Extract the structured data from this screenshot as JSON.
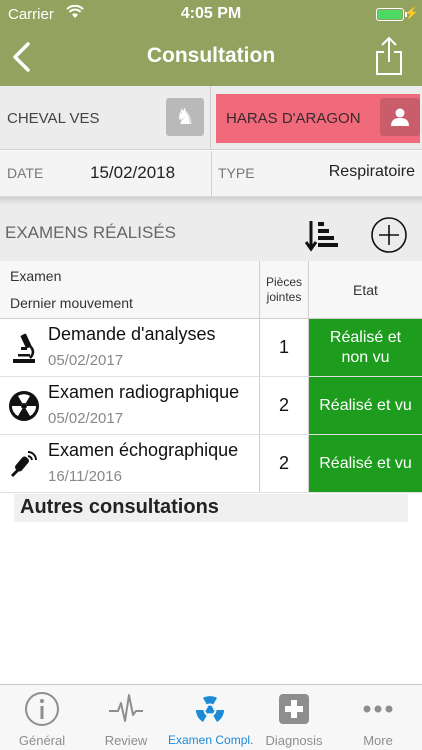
{
  "status_bar": {
    "carrier": "Carrier",
    "time": "4:05 PM"
  },
  "nav": {
    "title": "Consultation"
  },
  "horse": {
    "name": "CHEVAL VES"
  },
  "owner": {
    "name": "HARAS D'ARAGON"
  },
  "details": {
    "date_label": "DATE",
    "date_value": "15/02/2018",
    "type_label": "TYPE",
    "type_value": "Respiratoire"
  },
  "section": {
    "title": "EXAMENS RÉALISÉS"
  },
  "table": {
    "headers": {
      "examen": "Examen",
      "mouvement": "Dernier mouvement",
      "pieces_line1": "Pièces",
      "pieces_line2": "jointes",
      "etat": "Etat"
    },
    "rows": [
      {
        "icon": "microscope-icon",
        "name": "Demande d'analyses",
        "date": "05/02/2017",
        "count": "1",
        "status": "Réalisé et non vu"
      },
      {
        "icon": "radiation-icon",
        "name": "Examen radiographique",
        "date": "05/02/2017",
        "count": "2",
        "status": "Réalisé et vu"
      },
      {
        "icon": "ultrasound-probe-icon",
        "name": "Examen échographique",
        "date": "16/11/2016",
        "count": "2",
        "status": "Réalisé et vu"
      }
    ]
  },
  "autres": {
    "title": "Autres consultations"
  },
  "tabbar": {
    "tabs": [
      {
        "label": "Général",
        "icon": "info-icon"
      },
      {
        "label": "Review",
        "icon": "pulse-icon"
      },
      {
        "label": "Examen Compl.",
        "icon": "radiation-icon",
        "active": true
      },
      {
        "label": "Diagnosis",
        "icon": "medical-cross-icon"
      },
      {
        "label": "More",
        "icon": "more-icon"
      }
    ]
  },
  "colors": {
    "header": "#93a25f",
    "owner": "#f06a7c",
    "status_green": "#1e9c1e",
    "active_tab": "#1d8ad8"
  }
}
